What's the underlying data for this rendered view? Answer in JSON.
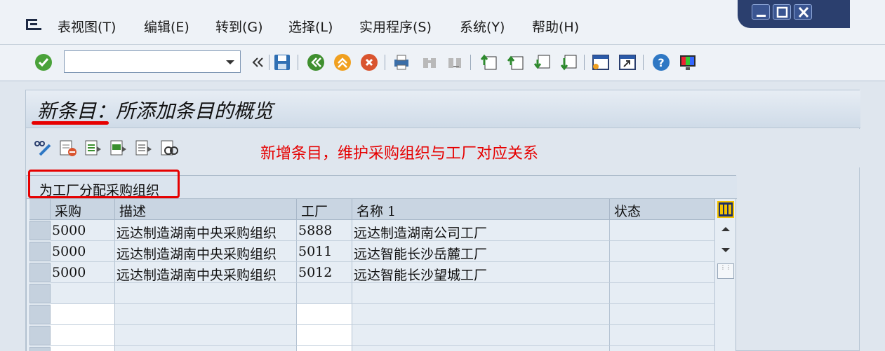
{
  "menu": {
    "items": [
      {
        "label": "表视图(T)"
      },
      {
        "label": "编辑(E)"
      },
      {
        "label": "转到(G)"
      },
      {
        "label": "选择(L)"
      },
      {
        "label": "实用程序(S)"
      },
      {
        "label": "系统(Y)"
      },
      {
        "label": "帮助(H)"
      }
    ]
  },
  "toolbar": {
    "command_value": "",
    "icons": [
      "enter-icon",
      "history-back-icon",
      "save-icon",
      "back-icon",
      "exit-icon",
      "cancel-icon",
      "print-icon",
      "find-icon",
      "find-next-icon",
      "first-page-icon",
      "prev-page-icon",
      "next-page-icon",
      "last-page-icon",
      "new-session-icon",
      "shortcut-icon",
      "help-icon",
      "layout-icon"
    ]
  },
  "screen": {
    "title": "新条目：所添加条目的概览",
    "annotation": "新增条目，维护采购组织与工厂对应关系",
    "app_icons": [
      "display-change-icon",
      "delete-icon",
      "select-all-icon",
      "select-block-icon",
      "deselect-all-icon",
      "details-icon"
    ]
  },
  "table": {
    "title": "为工厂分配采购组织",
    "columns": [
      "采购",
      "描述",
      "工厂",
      "名称 1",
      "状态"
    ],
    "rows": [
      {
        "purch": "5000",
        "desc": "远达制造湖南中央采购组织",
        "plant": "5888",
        "name": "远达制造湖南公司工厂",
        "status": ""
      },
      {
        "purch": "5000",
        "desc": "远达制造湖南中央采购组织",
        "plant": "5011",
        "name": "远达智能长沙岳麓工厂",
        "status": ""
      },
      {
        "purch": "5000",
        "desc": "远达制造湖南中央采购组织",
        "plant": "5012",
        "name": "远达智能长沙望城工厂",
        "status": ""
      }
    ]
  },
  "colors": {
    "annotation": "#e60000",
    "accent": "#2b3f6e"
  }
}
